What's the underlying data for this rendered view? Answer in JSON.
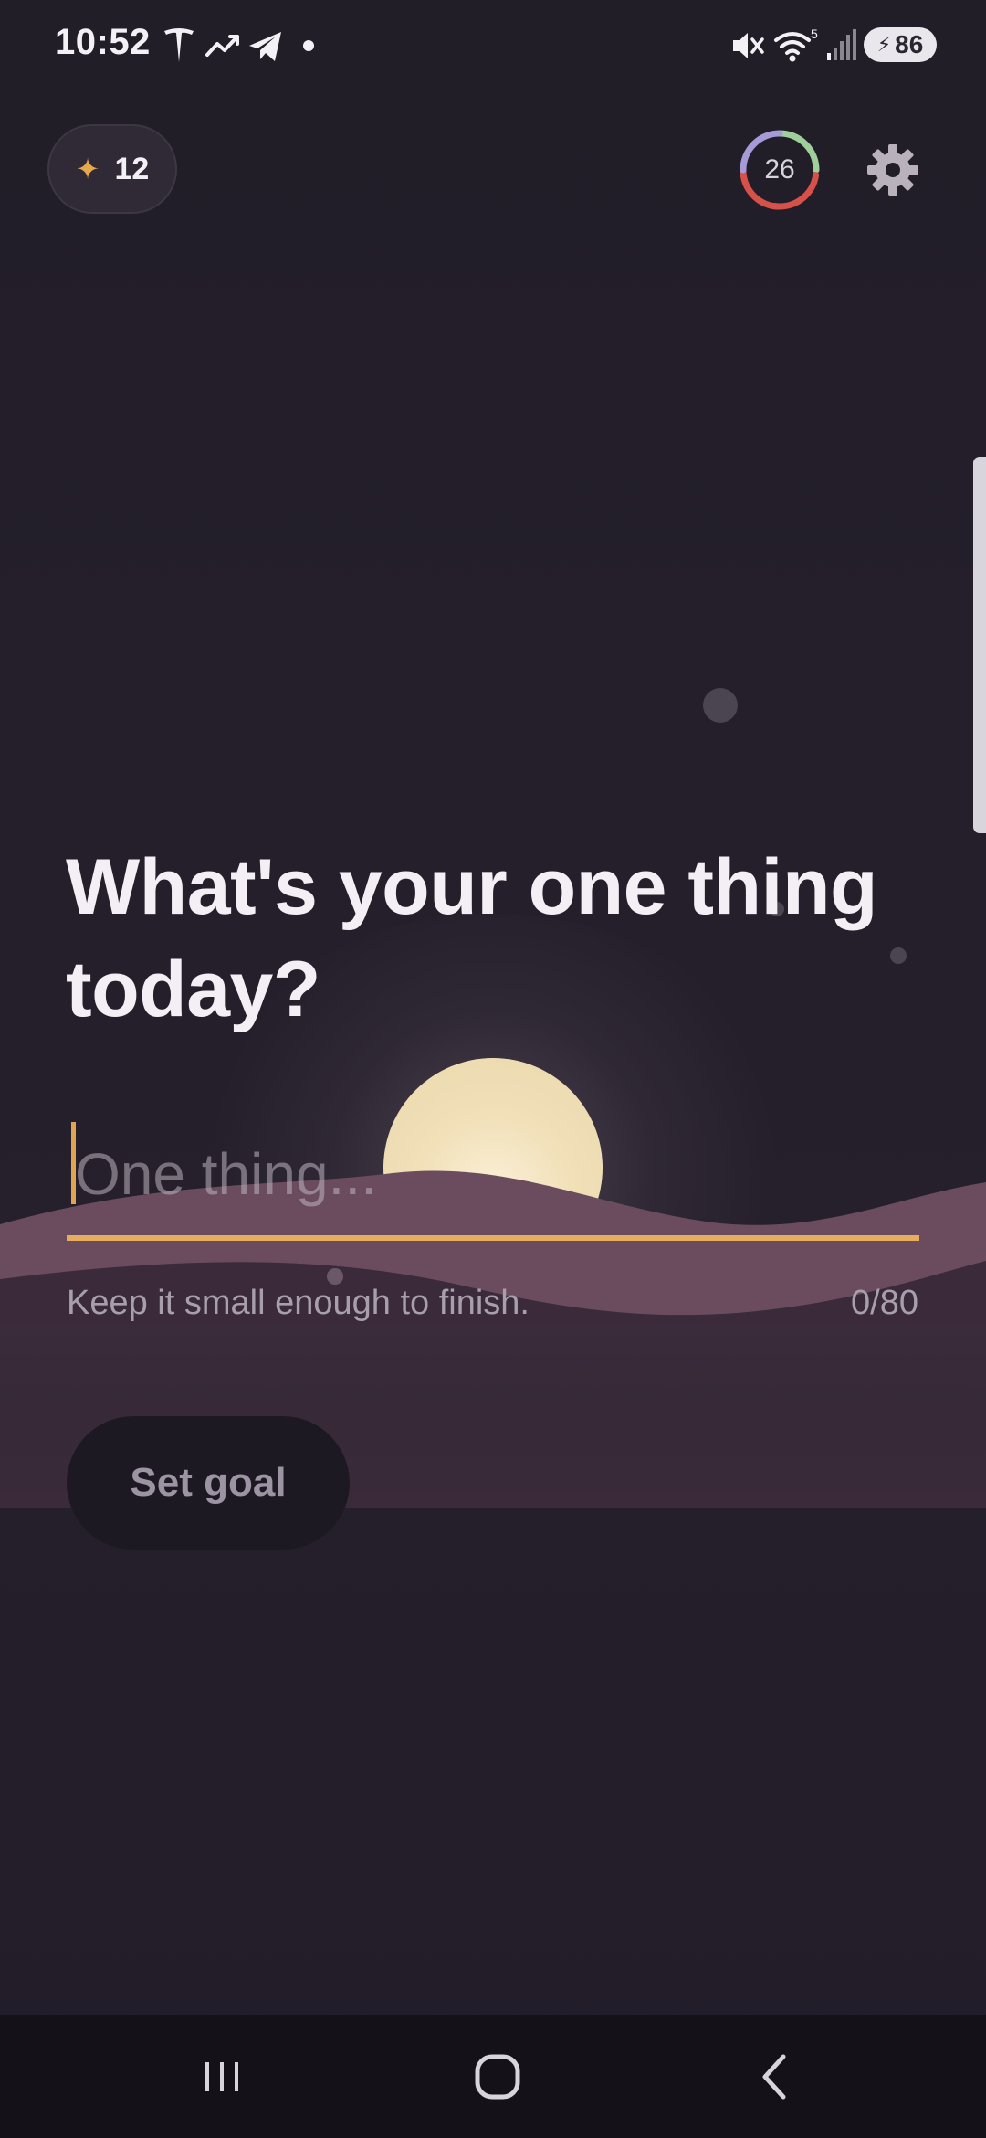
{
  "status_bar": {
    "time": "10:52",
    "battery_level": "86",
    "icons": [
      "tesla-icon",
      "trending-icon",
      "telegram-icon",
      "notification-dot-icon",
      "mute-icon",
      "wifi-icon",
      "signal-icon",
      "battery-charging-icon"
    ]
  },
  "header": {
    "streak_count": "12",
    "streak_icon": "sparkle-icon",
    "progress_ring_value": "26",
    "settings_icon": "gear-icon"
  },
  "main": {
    "headline": "What's your one thing today?",
    "input_placeholder": "One thing...",
    "input_value": "",
    "hint": "Keep it small enough to finish.",
    "char_count": "0/80",
    "set_goal_label": "Set goal"
  },
  "colors": {
    "accent": "#e6ad5f",
    "background": "#221e2a",
    "sun": "#f1e0b8",
    "hills": "#6b4c5e"
  },
  "nav": {
    "icons": [
      "recent-apps-icon",
      "home-icon",
      "back-icon"
    ]
  }
}
